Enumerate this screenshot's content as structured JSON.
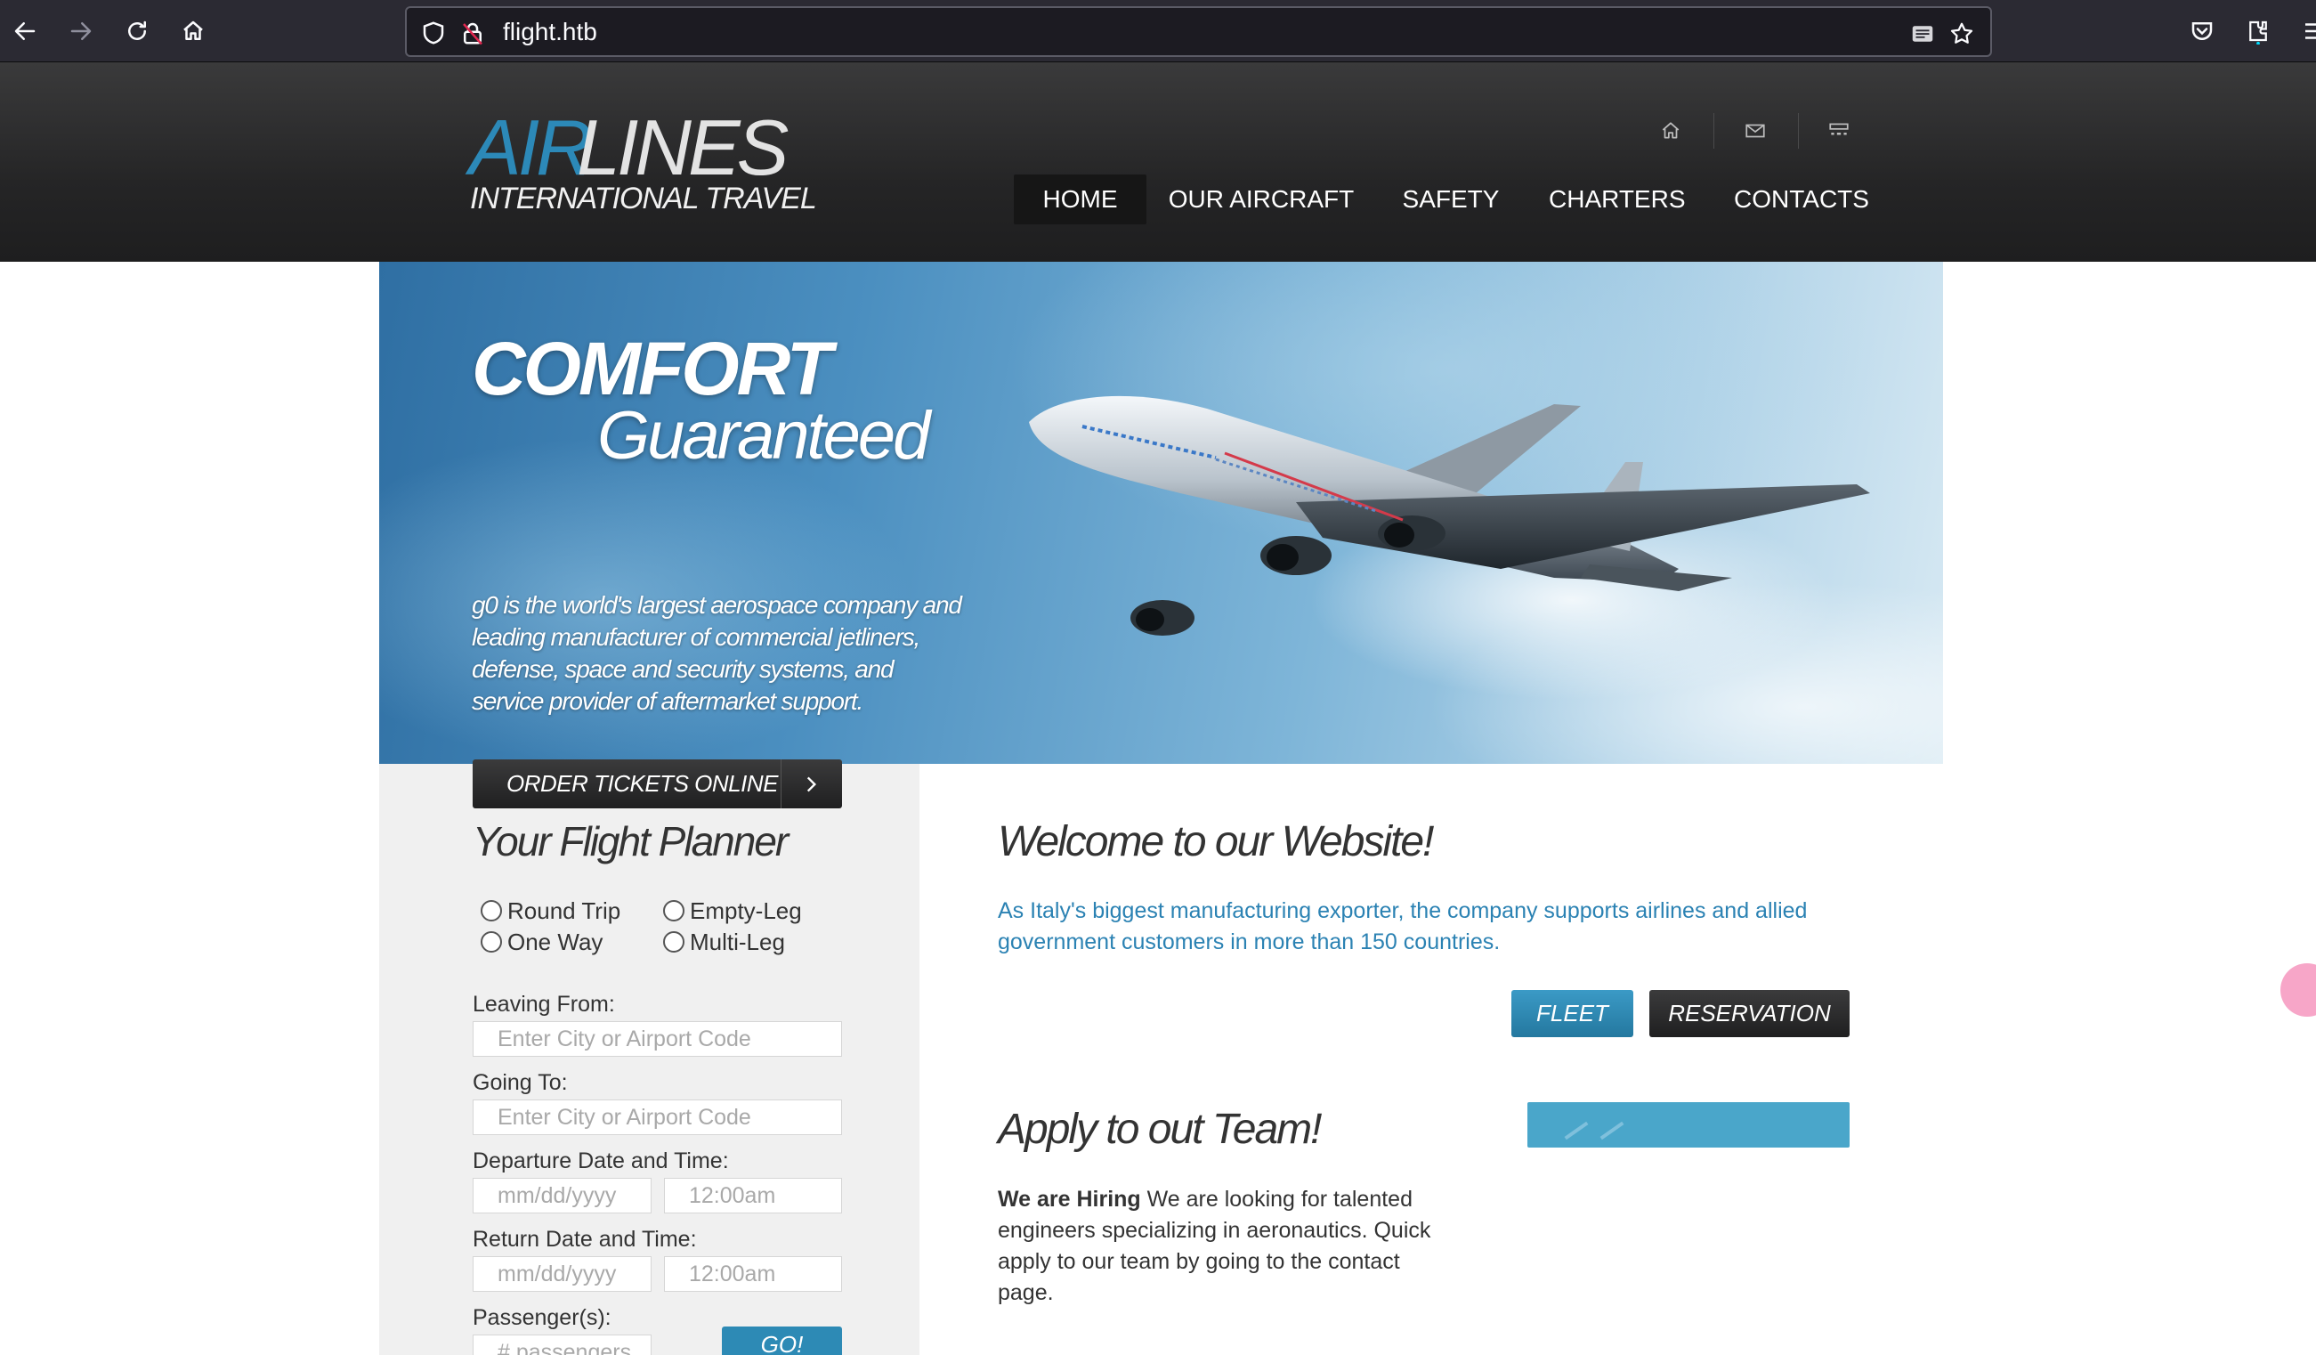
{
  "browser": {
    "url": "flight.htb",
    "icons": [
      "back-arrow-icon",
      "forward-arrow-icon",
      "reload-icon",
      "home-icon",
      "shield-icon",
      "lock-icon",
      "reader-mode-icon",
      "bookmark-star-icon",
      "pocket-icon",
      "extensions-icon",
      "menu-icon"
    ]
  },
  "logo": {
    "air": "AIR",
    "lines": "LINES",
    "subtitle": "INTERNATIONAL TRAVEL"
  },
  "header": {
    "top_icons": [
      "home-icon",
      "mail-icon",
      "sitemap-icon"
    ],
    "nav": [
      {
        "label": "HOME",
        "active": true
      },
      {
        "label": "OUR AIRCRAFT",
        "active": false
      },
      {
        "label": "SAFETY",
        "active": false
      },
      {
        "label": "CHARTERS",
        "active": false
      },
      {
        "label": "CONTACTS",
        "active": false
      }
    ]
  },
  "hero": {
    "title_line1": "COMFORT",
    "title_line2": "Guaranteed",
    "description": "g0 is the world's largest aerospace company and leading manufacturer of commercial jetliners, defense, space and security systems, and service provider of aftermarket support."
  },
  "planner": {
    "order_label": "ORDER TICKETS ONLINE",
    "title": "Your Flight Planner",
    "trip_types": [
      "Round Trip",
      "Empty-Leg",
      "One Way",
      "Multi-Leg"
    ],
    "leaving_label": "Leaving From:",
    "leaving_placeholder": "Enter City or Airport Code",
    "going_label": "Going To:",
    "going_placeholder": "Enter City or Airport Code",
    "departure_label": "Departure Date and Time:",
    "departure_date_placeholder": "mm/dd/yyyy",
    "departure_time_placeholder": "12:00am",
    "return_label": "Return Date and Time:",
    "return_date_placeholder": "mm/dd/yyyy",
    "return_time_placeholder": "12:00am",
    "passengers_label": "Passenger(s):",
    "passengers_placeholder": "# passengers",
    "go_label": "GO!"
  },
  "welcome": {
    "title": "Welcome to our Website!",
    "text": "As Italy's biggest manufacturing exporter, the company supports airlines and allied government customers in more than 150 countries.",
    "fleet_label": "FLEET",
    "reservation_label": "RESERVATION"
  },
  "apply": {
    "title": "Apply to out Team!",
    "bold": "We are Hiring",
    "text": " We are looking for talented engineers specializing in aeronautics. Quick apply to our team by going to the contact page."
  },
  "colors": {
    "brand_blue": "#2c89b8",
    "header_dark": "#252526",
    "link_blue": "#2b82b3"
  }
}
